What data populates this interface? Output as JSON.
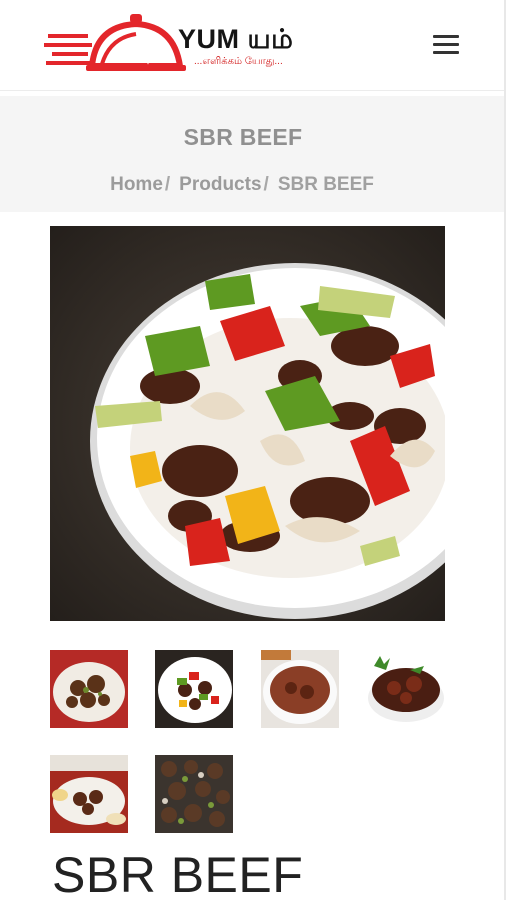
{
  "brand": {
    "name": "YUM யம்",
    "tagline": "...எளிக்கம் யோது..."
  },
  "nav": {
    "menu_icon": "hamburger-icon"
  },
  "banner": {
    "title": "SBR BEEF",
    "breadcrumb": [
      {
        "label": "Home",
        "separator": "/"
      },
      {
        "label": "Products",
        "separator": "/"
      },
      {
        "label": "SBR BEEF",
        "separator": ""
      }
    ]
  },
  "product": {
    "title": "SBR BEEF",
    "gallery_count": 6
  },
  "colors": {
    "brand_red": "#e3262b",
    "banner_bg": "#f5f5f5",
    "breadcrumb_text": "#a0a0a0"
  }
}
